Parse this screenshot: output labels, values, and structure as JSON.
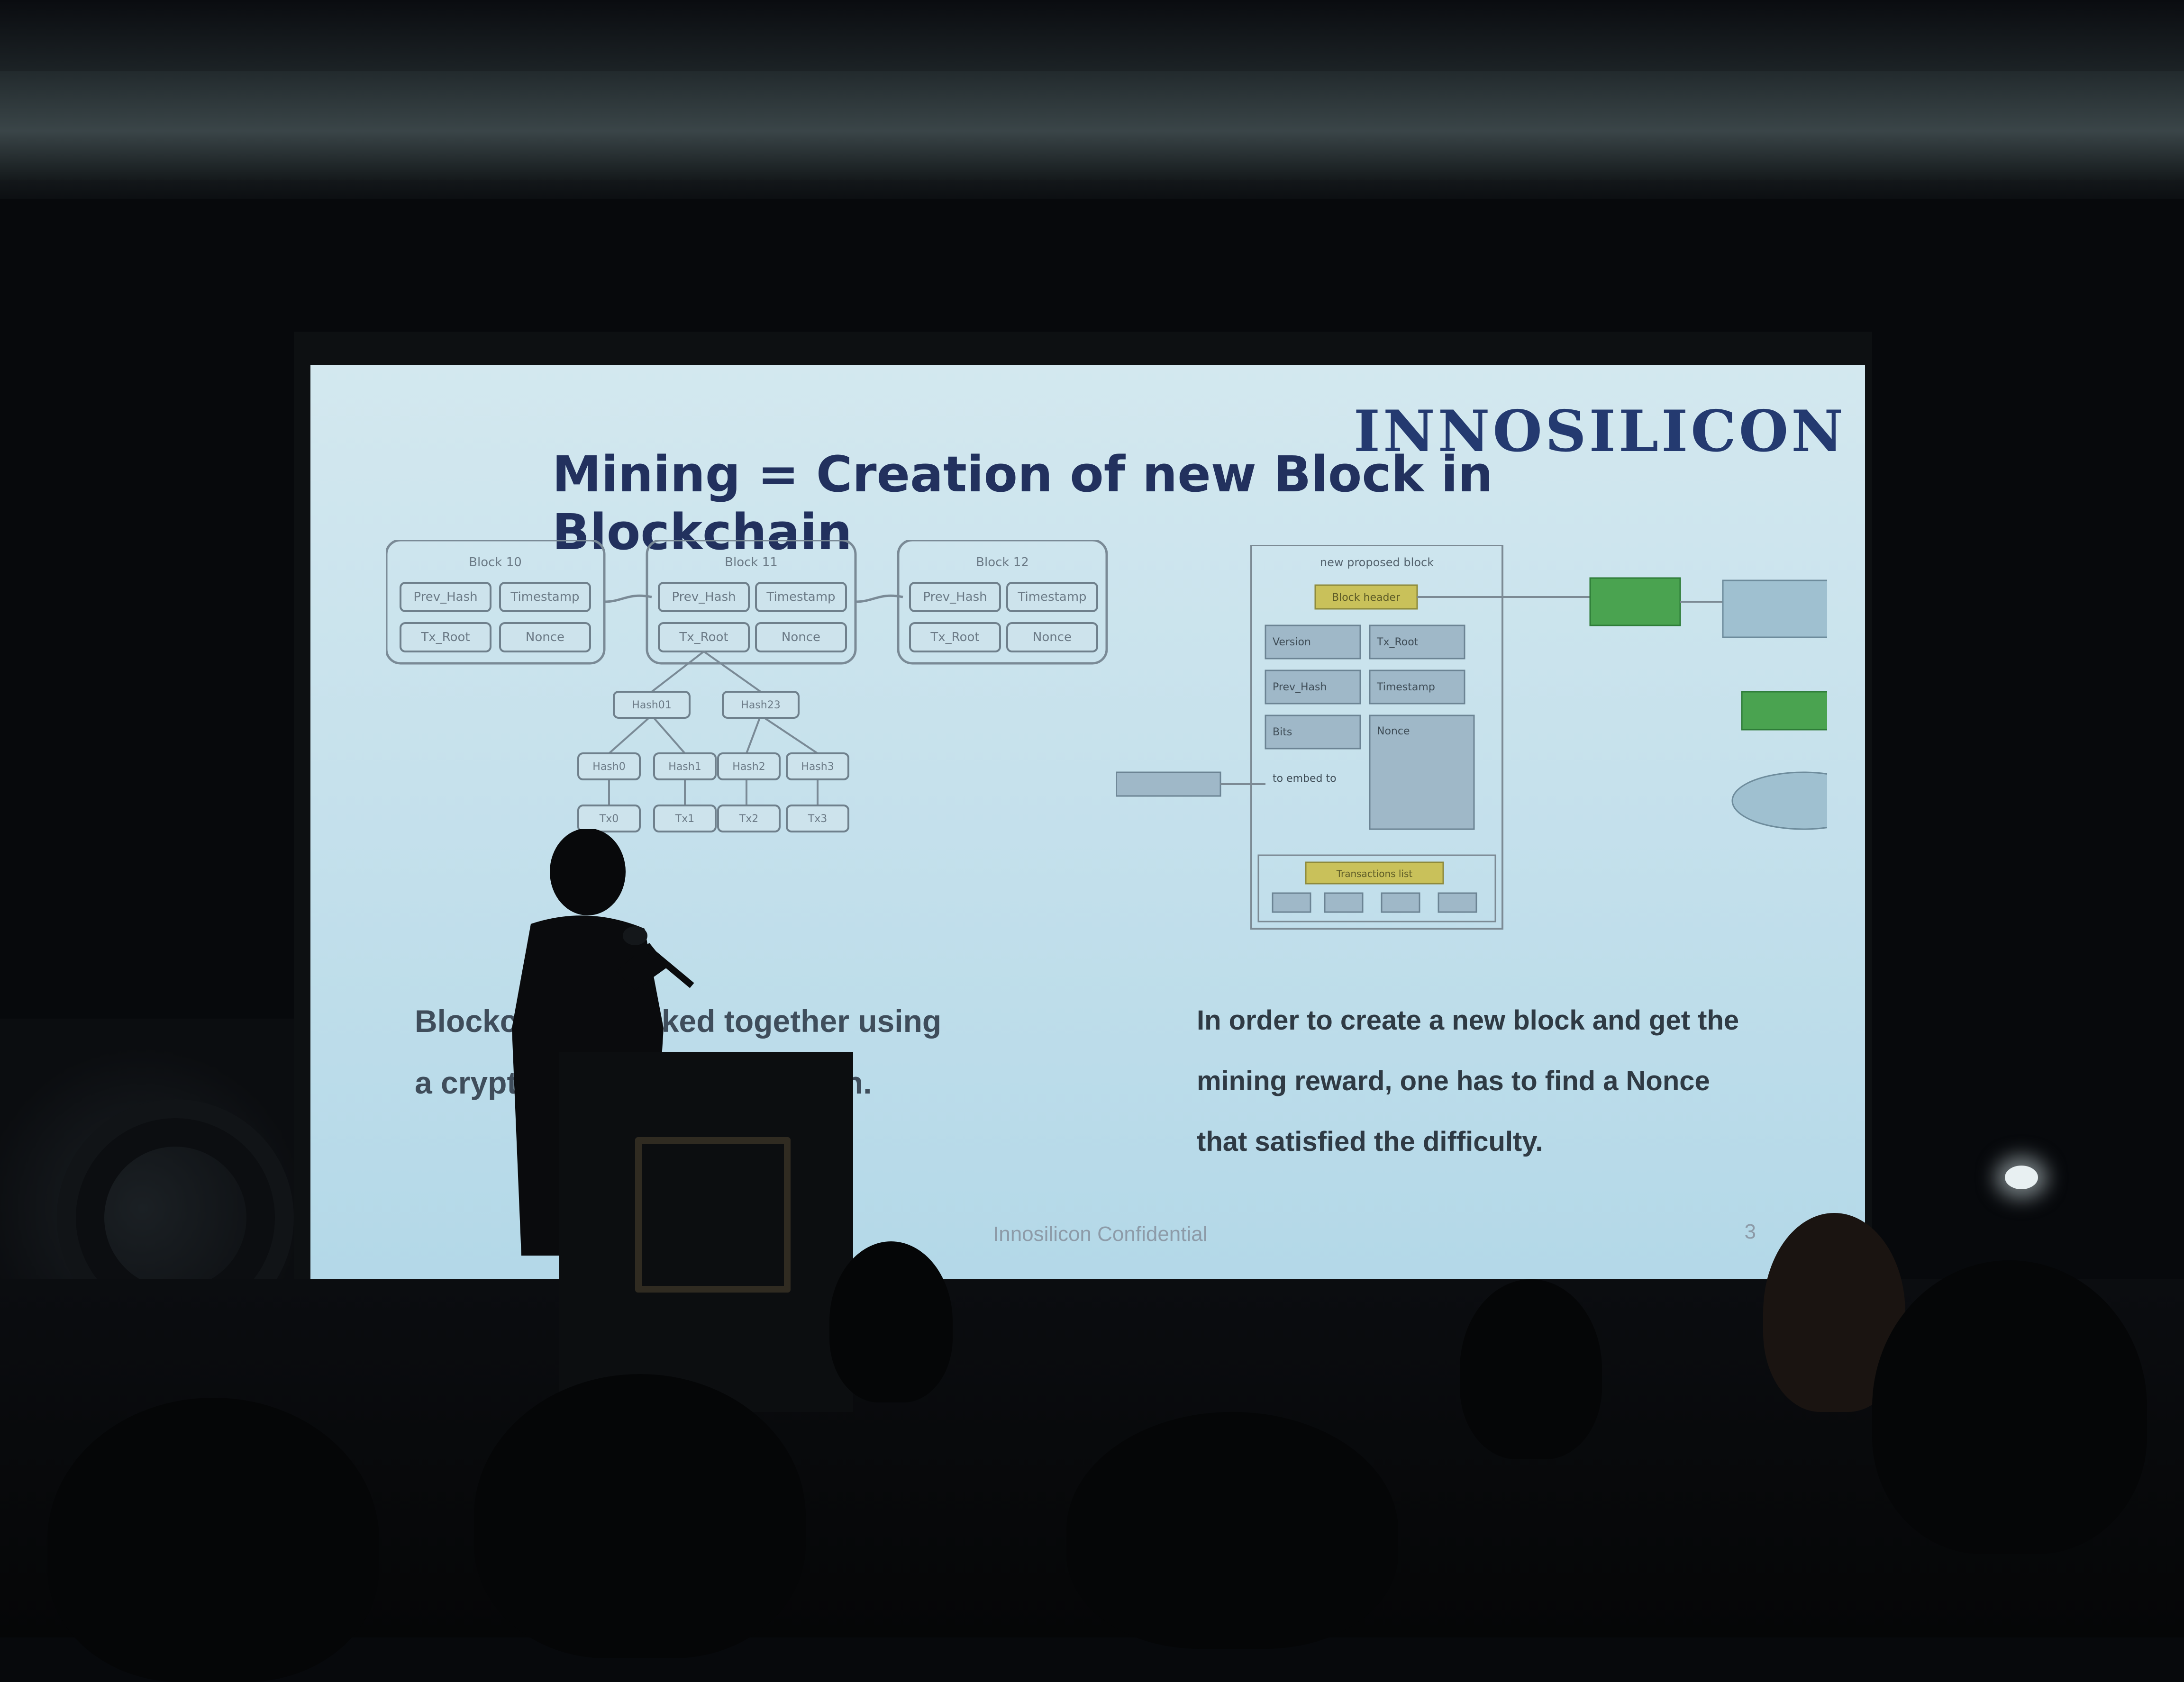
{
  "slide": {
    "logo": "INNOSILICON",
    "title": "Mining = Creation of new Block in Blockchain",
    "caption_left_line1": "Blockchain is linked together using",
    "caption_left_line2": "a cryptographic hash function.",
    "caption_right_line1": "In order to create a new block and get the",
    "caption_right_line2": "mining reward, one has to find a Nonce",
    "caption_right_line3": "that satisfied the difficulty.",
    "footer": "Innosilicon  Confidential",
    "page_number": "3"
  },
  "chain_diagram": {
    "blocks": [
      {
        "title": "Block 10",
        "fields": [
          "Prev_Hash",
          "Timestamp",
          "Tx_Root",
          "Nonce"
        ]
      },
      {
        "title": "Block 11",
        "fields": [
          "Prev_Hash",
          "Timestamp",
          "Tx_Root",
          "Nonce"
        ]
      },
      {
        "title": "Block 12",
        "fields": [
          "Prev_Hash",
          "Timestamp",
          "Tx_Root",
          "Nonce"
        ]
      }
    ],
    "hash_level1": [
      "Hash01",
      "Hash23"
    ],
    "hash_level2": [
      "Hash0",
      "Hash1",
      "Hash2",
      "Hash3"
    ],
    "transactions": [
      "Tx0",
      "Tx1",
      "Tx2",
      "Tx3"
    ]
  },
  "flow_diagram": {
    "header": "new proposed block",
    "block_header_label": "Block header",
    "fields": [
      "Version",
      "Tx_Root",
      "Prev_Hash",
      "Timestamp",
      "Bits"
    ],
    "nonce_label": "Nonce",
    "to_embed": "to embed to",
    "transactions_label": "Transactions list"
  }
}
